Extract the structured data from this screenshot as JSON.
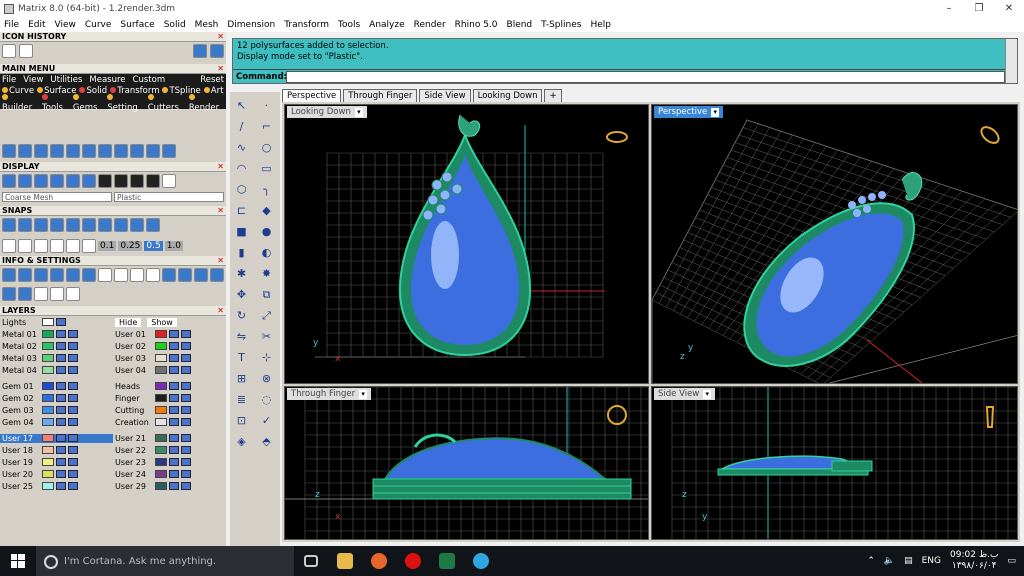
{
  "window": {
    "title": "Matrix 8.0 (64-bit) - 1.2render.3dm"
  },
  "menu": [
    "File",
    "Edit",
    "View",
    "Curve",
    "Surface",
    "Solid",
    "Mesh",
    "Dimension",
    "Transform",
    "Tools",
    "Analyze",
    "Render",
    "Rhino 5.0",
    "Blend",
    "T-Splines",
    "Help"
  ],
  "panels": {
    "icon_history": "ICON HISTORY",
    "main_menu": "MAIN MENU",
    "main_menu_bar": [
      "File",
      "View",
      "Utilities",
      "Measure",
      "Custom"
    ],
    "reset": "Reset",
    "mm_row1": [
      {
        "label": "Curve",
        "color": "#f2b632"
      },
      {
        "label": "Surface",
        "color": "#f2b632"
      },
      {
        "label": "Solid",
        "color": "#e04040"
      },
      {
        "label": "Transform",
        "color": "#e04040"
      },
      {
        "label": "TSpline",
        "color": "#f2b632"
      },
      {
        "label": "Art",
        "color": "#f2b632"
      }
    ],
    "mm_row2": [
      {
        "label": "Builder",
        "color": "#f2b632"
      },
      {
        "label": "Tools",
        "color": "#e04040"
      },
      {
        "label": "Gems",
        "color": "#f2b632"
      },
      {
        "label": "Setting",
        "color": "#f2b632"
      },
      {
        "label": "Cutters",
        "color": "#f2b632"
      },
      {
        "label": "Render",
        "color": "#f2b632"
      }
    ],
    "display": "DISPLAY",
    "display_mode_left": "Coarse Mesh",
    "display_mode_right": "Plastic",
    "snaps": "SNAPS",
    "snap_values": [
      "0.1",
      "0.25",
      "0.5",
      "1.0"
    ],
    "info": "INFO & SETTINGS",
    "layers": "LAYERS",
    "lights": "Lights",
    "hide": "Hide",
    "show": "Show"
  },
  "layers": [
    [
      {
        "name": "Metal 01",
        "color": "#14a85b"
      },
      {
        "name": "User 01",
        "color": "#e02020"
      }
    ],
    [
      {
        "name": "Metal 02",
        "color": "#29c26a"
      },
      {
        "name": "User 02",
        "color": "#19d119"
      }
    ],
    [
      {
        "name": "Metal 03",
        "color": "#5fcf7f"
      },
      {
        "name": "User 03",
        "color": "#e2e0d0"
      }
    ],
    [
      {
        "name": "Metal 04",
        "color": "#8fe0a0"
      },
      {
        "name": "User 04",
        "color": "#707070"
      }
    ],
    [
      {
        "name": "Gem 01",
        "color": "#1c4fd0"
      },
      {
        "name": "Heads",
        "color": "#7a2bb5"
      }
    ],
    [
      {
        "name": "Gem 02",
        "color": "#2c6fe0"
      },
      {
        "name": "Finger",
        "color": "#1d1d1d"
      }
    ],
    [
      {
        "name": "Gem 03",
        "color": "#3c8de8"
      },
      {
        "name": "Cutting",
        "color": "#f07a0a"
      }
    ],
    [
      {
        "name": "Gem 04",
        "color": "#6aa9f0"
      },
      {
        "name": "Creation",
        "color": "#e4e4e4"
      }
    ],
    [
      {
        "name": "User 17",
        "color": "#f08080"
      },
      {
        "name": "User 21",
        "color": "#3a6a5a"
      }
    ],
    [
      {
        "name": "User 18",
        "color": "#f0c0a0"
      },
      {
        "name": "User 22",
        "color": "#3a8a6a"
      }
    ],
    [
      {
        "name": "User 19",
        "color": "#f0f080"
      },
      {
        "name": "User 23",
        "color": "#2a3a8a"
      }
    ],
    [
      {
        "name": "User 20",
        "color": "#e0e060"
      },
      {
        "name": "User 24",
        "color": "#7a3a8a"
      }
    ],
    [
      {
        "name": "User 25",
        "color": "#a0f0f0"
      },
      {
        "name": "User 29",
        "color": "#2a5a5a"
      }
    ]
  ],
  "command": {
    "history": [
      "12 polysurfaces added to selection.",
      "Display mode set to \"Plastic\"."
    ],
    "label": "Command:"
  },
  "tabs": [
    "Perspective",
    "Through Finger",
    "Side View",
    "Looking Down",
    "+"
  ],
  "viewports": {
    "top_left": "Looking Down",
    "top_right": "Perspective",
    "bottom_left": "Through Finger",
    "bottom_right": "Side View"
  },
  "taskbar": {
    "search": "I'm Cortana. Ask me anything.",
    "lang": "ENG",
    "time": "09:02 ب.ظ",
    "date": "۱۳۹۸/۰۶/۰۴"
  }
}
